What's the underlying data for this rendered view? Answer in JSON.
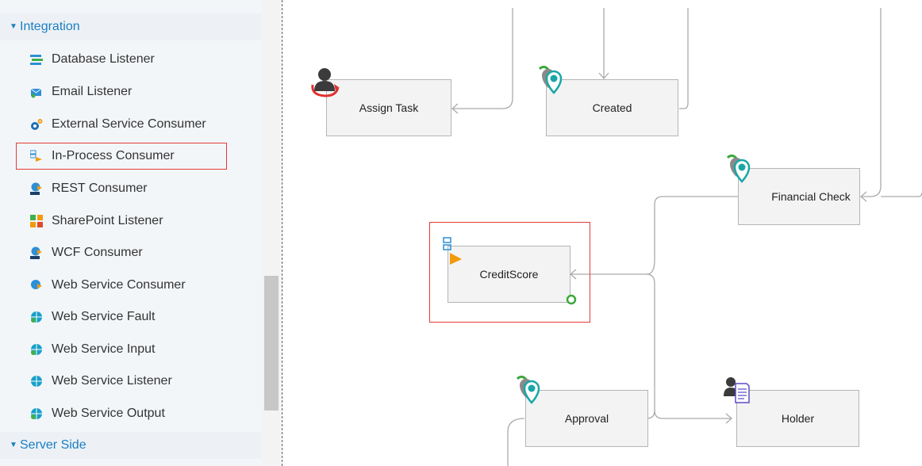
{
  "toolbox": {
    "sections": [
      {
        "label": "Integration",
        "state": "expanded"
      },
      {
        "label": "Server Side",
        "state": "expanded"
      }
    ],
    "items": [
      {
        "label": "Database Listener",
        "icon": "database-listener-icon"
      },
      {
        "label": "Email Listener",
        "icon": "email-listener-icon"
      },
      {
        "label": "External Service Consumer",
        "icon": "external-service-icon"
      },
      {
        "label": "In-Process Consumer",
        "icon": "in-process-consumer-icon",
        "selected": true
      },
      {
        "label": "REST Consumer",
        "icon": "rest-consumer-icon"
      },
      {
        "label": "SharePoint Listener",
        "icon": "sharepoint-icon"
      },
      {
        "label": "WCF Consumer",
        "icon": "wcf-consumer-icon"
      },
      {
        "label": "Web Service Consumer",
        "icon": "web-service-consumer-icon"
      },
      {
        "label": "Web Service Fault",
        "icon": "web-service-fault-icon"
      },
      {
        "label": "Web Service Input",
        "icon": "web-service-input-icon"
      },
      {
        "label": "Web Service Listener",
        "icon": "web-service-listener-icon"
      },
      {
        "label": "Web Service Output",
        "icon": "web-service-output-icon"
      }
    ]
  },
  "workflow": {
    "nodes": [
      {
        "label": "Assign Task",
        "icon": "assign-task-icon"
      },
      {
        "label": "Created",
        "icon": "status-pin-icon"
      },
      {
        "label": "Financial Check",
        "icon": "status-pin-icon"
      },
      {
        "label": "CreditScore",
        "icon": "in-process-consumer-icon",
        "highlighted": true
      },
      {
        "label": "Approval",
        "icon": "status-pin-icon"
      },
      {
        "label": "Holder",
        "icon": "user-document-icon"
      }
    ]
  },
  "colors": {
    "accent": "#1a7fc3",
    "highlight": "#e23a3a",
    "connector": "#aaaaaa",
    "node_fill": "#f3f3f3",
    "status_pin": "#1aa6a6",
    "refresh_arrow": "#3aa83a"
  }
}
